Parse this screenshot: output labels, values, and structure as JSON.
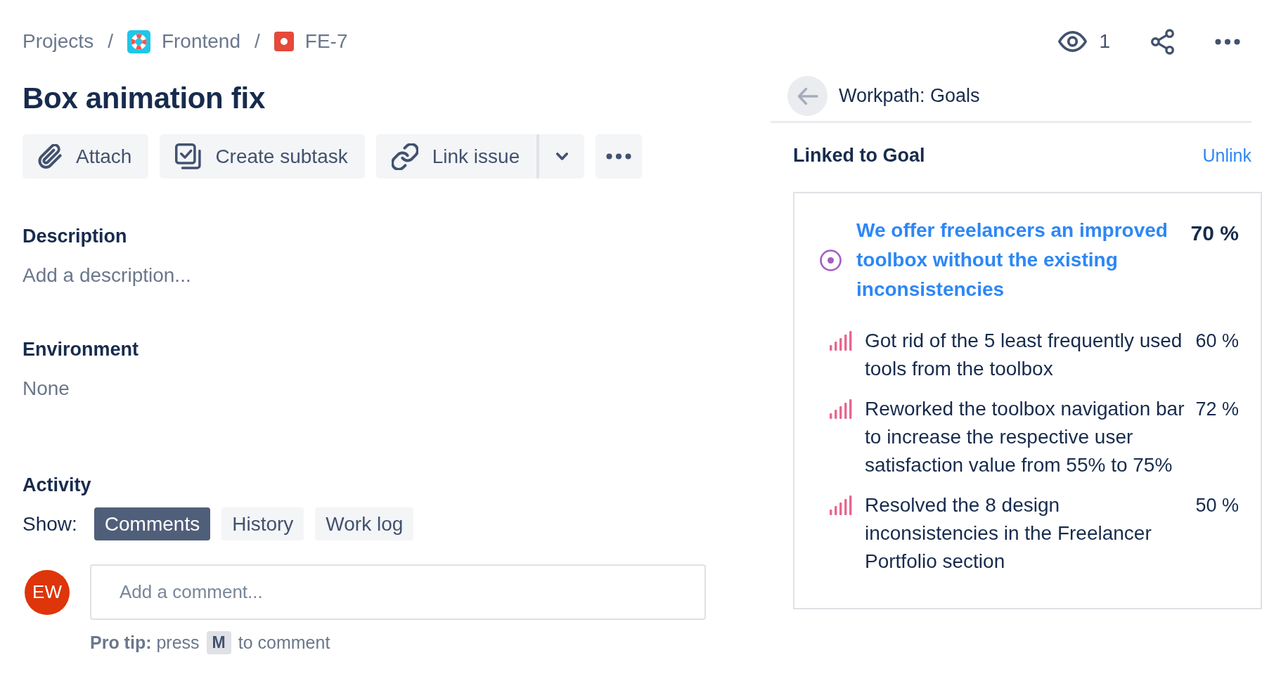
{
  "breadcrumbs": [
    {
      "kind": "link",
      "label": "Projects"
    },
    {
      "kind": "separator",
      "label": "/"
    },
    {
      "kind": "project",
      "label": "Frontend"
    },
    {
      "kind": "separator",
      "label": "/"
    },
    {
      "kind": "issue",
      "label": "FE-7"
    }
  ],
  "issue": {
    "title": "Box animation fix"
  },
  "toolbar": [
    {
      "kind": "attach",
      "label": "Attach"
    },
    {
      "kind": "subtask",
      "label": "Create subtask"
    },
    {
      "kind": "link",
      "label": "Link issue"
    },
    {
      "kind": "dropdown"
    },
    {
      "kind": "more"
    }
  ],
  "fields": [
    {
      "label": "Description",
      "placeholder": "Add a description..."
    },
    {
      "label": "Environment",
      "value": "None"
    }
  ],
  "activity": {
    "title": "Activity",
    "show_label": "Show:",
    "filters": [
      {
        "label": "Comments",
        "selected": true
      },
      {
        "label": "History",
        "selected": false
      },
      {
        "label": "Work log",
        "selected": false
      }
    ],
    "comment": {
      "avatar_initials": "EW",
      "placeholder": "Add a comment..."
    },
    "pro_tip": {
      "before": "**Pro tip:** press",
      "key": "M",
      "after": "to comment"
    }
  },
  "header_actions": [
    {
      "kind": "watch",
      "label": "1"
    },
    {
      "kind": "share"
    },
    {
      "kind": "more"
    }
  ],
  "goals_panel": {
    "title": "Workpath: Goals",
    "section_title": "Linked to Goal",
    "unlink": "Unlink",
    "goal": {
      "title": "We offer freelancers an improved toolbox without the existing inconsistencies",
      "progress": "70 %"
    },
    "key_results": [
      {
        "title": "Got rid of the 5 least frequently used tools from the toolbox",
        "progress": "60 %"
      },
      {
        "title": "Reworked the toolbox navigation bar to increase the respective user satisfaction value from 55% to 75%",
        "progress": "72 %"
      },
      {
        "title": "Resolved the 8 design inconsistencies in the Freelancer Portfolio section",
        "progress": "50 %"
      }
    ]
  }
}
